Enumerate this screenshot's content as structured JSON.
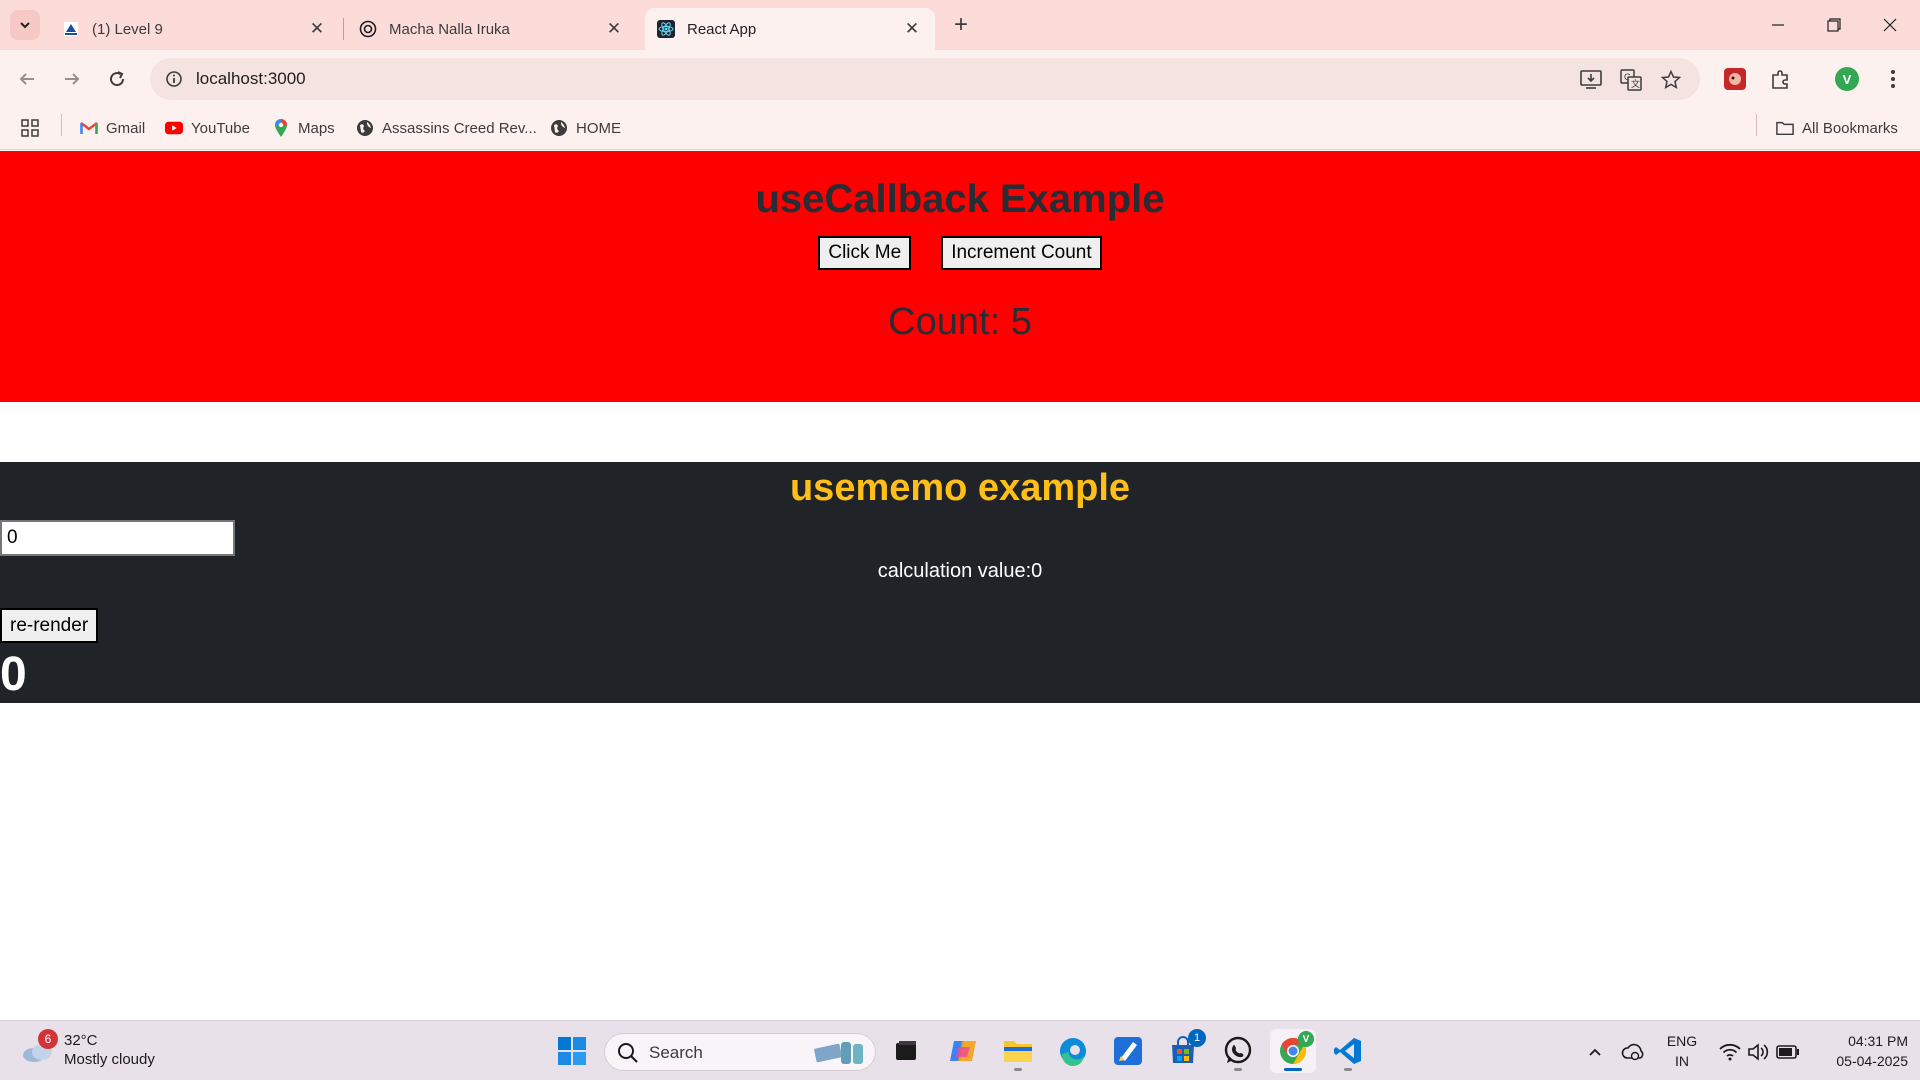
{
  "browser": {
    "tabs": [
      {
        "title": "(1) Level 9",
        "icon": "skillrack-icon"
      },
      {
        "title": "Macha Nalla Iruka",
        "icon": "chatgpt-icon"
      },
      {
        "title": "React App",
        "icon": "react-icon"
      }
    ],
    "address": "localhost:3000",
    "bookmarks": [
      {
        "label": "Gmail",
        "icon": "gmail-icon"
      },
      {
        "label": "YouTube",
        "icon": "youtube-icon"
      },
      {
        "label": "Maps",
        "icon": "maps-icon"
      },
      {
        "label": "Assassins Creed Rev...",
        "icon": "globe-icon"
      },
      {
        "label": "HOME",
        "icon": "globe-icon"
      }
    ],
    "all_bookmarks": "All Bookmarks",
    "profile_initial": "V"
  },
  "page": {
    "callback": {
      "title": "useCallback Example",
      "click_button": "Click Me",
      "increment_button": "Increment Count",
      "count_text": "Count: 5",
      "bg_color": "#ff0000"
    },
    "memo": {
      "title": "usememo example",
      "input_value": "0",
      "calc_text": "calculation value:0",
      "rerender_button": "re-render",
      "counter": "0",
      "bg_color": "#202327",
      "title_color": "#ffbf18"
    }
  },
  "taskbar": {
    "weather_temp": "32°C",
    "weather_desc": "Mostly cloudy",
    "weather_badge": "6",
    "search_label": "Search",
    "store_badge": "1",
    "chrome_badge": "V",
    "lang_top": "ENG",
    "lang_bottom": "IN",
    "time": "04:31 PM",
    "date": "05-04-2025"
  }
}
